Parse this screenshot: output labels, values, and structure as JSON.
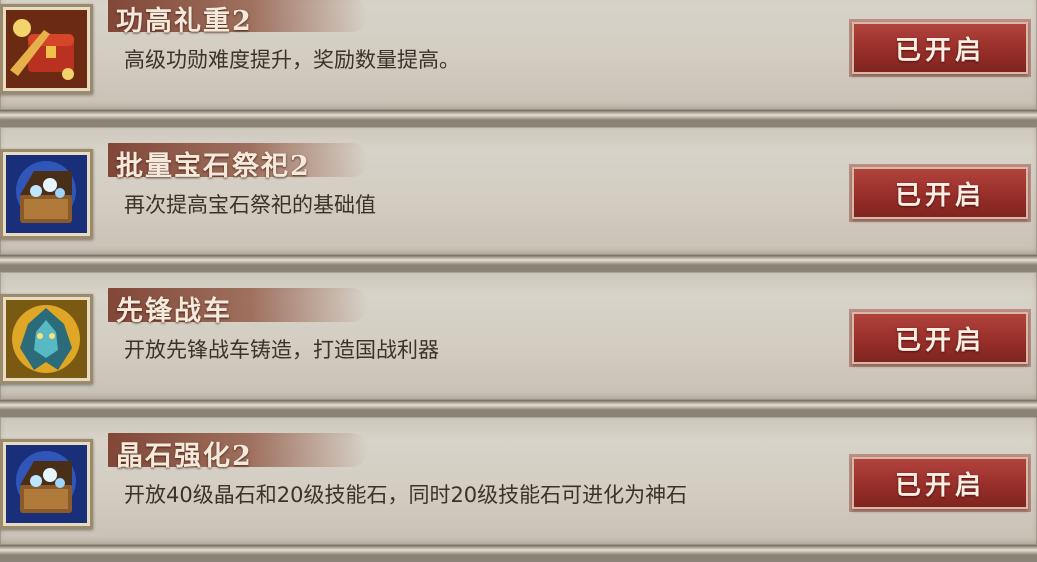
{
  "items": [
    {
      "title": "功高礼重2",
      "description": "高级功勋难度提升，奖励数量提高。",
      "status": "已开启",
      "icon": "red-treasure-chest-icon"
    },
    {
      "title": "批量宝石祭祀2",
      "description": "再次提高宝石祭祀的基础值",
      "status": "已开启",
      "icon": "blue-gem-chest-icon"
    },
    {
      "title": "先锋战车",
      "description": "开放先锋战车铸造，打造国战利器",
      "status": "已开启",
      "icon": "war-chariot-emblem-icon"
    },
    {
      "title": "晶石强化2",
      "description": "开放40级晶石和20级技能石，同时20级技能石可进化为神石",
      "status": "已开启",
      "icon": "blue-gem-chest-icon"
    }
  ],
  "colors": {
    "button": "#982e2a",
    "title_band": "#7a3a2a",
    "panel": "#d3cdc2"
  }
}
